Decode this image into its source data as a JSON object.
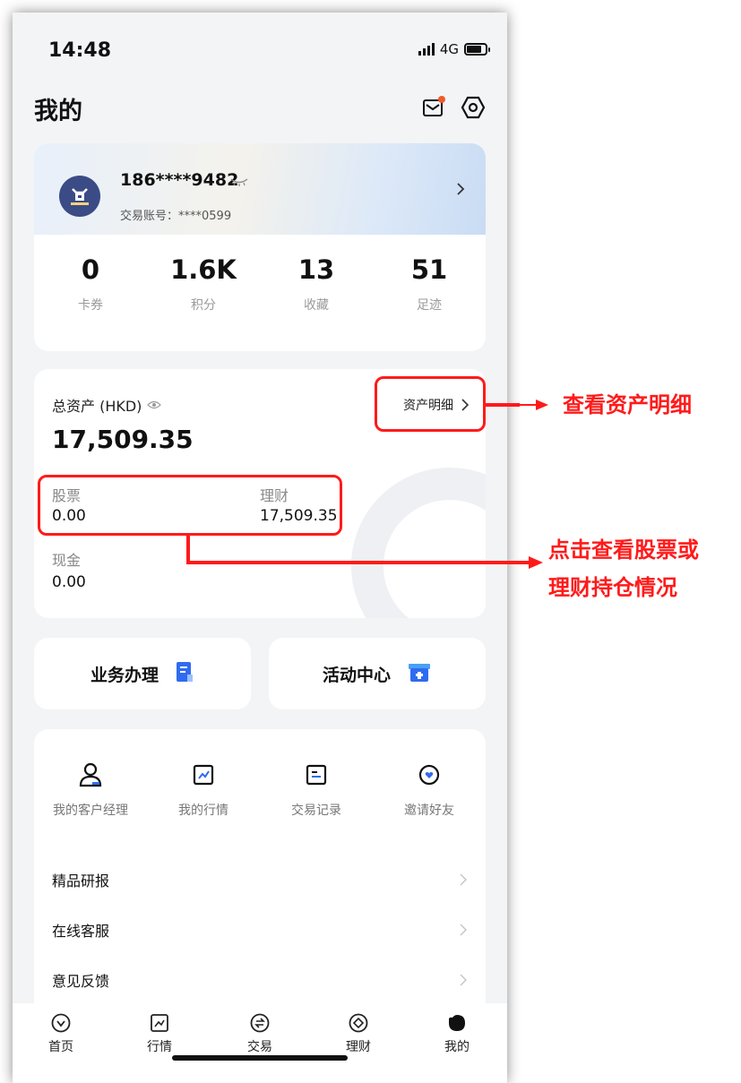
{
  "status": {
    "time": "14:48",
    "network": "4G"
  },
  "header": {
    "title": "我的"
  },
  "profile": {
    "phone": "186****9482",
    "account_label": "交易账号：",
    "account_value": "****0599"
  },
  "stats": [
    {
      "value": "0",
      "label": "卡券"
    },
    {
      "value": "1.6K",
      "label": "积分"
    },
    {
      "value": "13",
      "label": "收藏"
    },
    {
      "value": "51",
      "label": "足迹"
    }
  ],
  "assets": {
    "total_label": "总资产 (HKD)",
    "total_value": "17,509.35",
    "detail_label": "资产明细",
    "stock_label": "股票",
    "stock_value": "0.00",
    "finance_label": "理财",
    "finance_value": "17,509.35",
    "cash_label": "现金",
    "cash_value": "0.00"
  },
  "services": [
    {
      "label": "业务办理",
      "icon": "document-icon"
    },
    {
      "label": "活动中心",
      "icon": "gift-box-icon"
    }
  ],
  "quick_links": [
    {
      "label": "我的客户经理",
      "icon": "person-icon"
    },
    {
      "label": "我的行情",
      "icon": "chart-icon"
    },
    {
      "label": "交易记录",
      "icon": "record-icon"
    },
    {
      "label": "邀请好友",
      "icon": "heart-circle-icon"
    }
  ],
  "menu": [
    "精品研报",
    "在线客服",
    "意见反馈"
  ],
  "tabs": [
    "首页",
    "行情",
    "交易",
    "理财",
    "我的"
  ],
  "annotations": {
    "detail_note": "查看资产明细",
    "holdings_note_line1": "点击查看股票或",
    "holdings_note_line2": "理财持仓情况"
  },
  "colors": {
    "accent": "#2f6bf0",
    "annotation_red": "#ff1a1a",
    "notify_dot": "#f05a2a"
  }
}
